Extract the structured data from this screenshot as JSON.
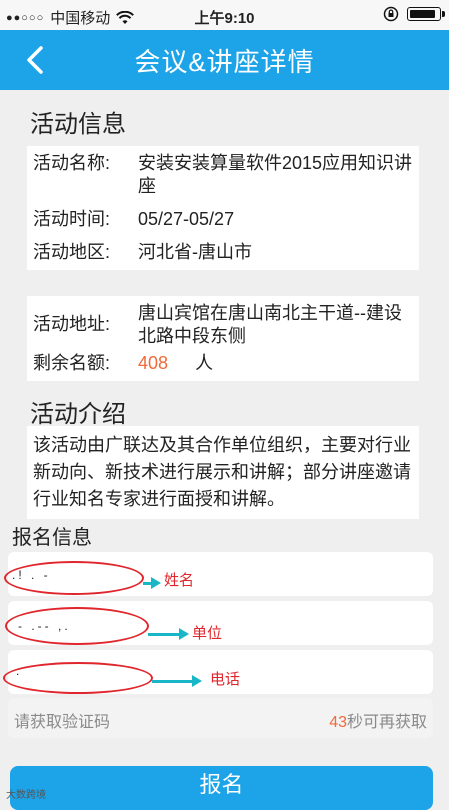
{
  "status_bar": {
    "carrier": "中国移动",
    "time": "上午9:10",
    "battery_level": 0.92
  },
  "nav": {
    "title": "会议&讲座详情"
  },
  "activity_info": {
    "heading": "活动信息",
    "rows": [
      {
        "label": "活动名称:",
        "value": "安装安装算量软件2015应用知识讲座"
      },
      {
        "label": "活动时间:",
        "value": "05/27-05/27"
      },
      {
        "label": "活动地区:",
        "value": "河北省-唐山市"
      }
    ],
    "address_label": "活动地址:",
    "address_value": "唐山宾馆在唐山南北主干道--建设北路中段东侧",
    "remaining_label": "剩余名额:",
    "remaining_count": "408",
    "remaining_unit": "人"
  },
  "intro": {
    "heading": "活动介绍",
    "text": "该活动由广联达及其合作单位组织，主要对行业新动向、新技术进行展示和讲解；部分讲座邀请行业知名专家进行面授和讲解。"
  },
  "form": {
    "heading": "报名信息",
    "fields": [
      {
        "annotation": "姓名"
      },
      {
        "annotation": "单位"
      },
      {
        "annotation": "电话"
      }
    ],
    "code_placeholder": "请获取验证码",
    "resend_count": "43",
    "resend_text": "秒可再获取",
    "submit_label": "报名"
  },
  "watermark": "大数跨境",
  "colors": {
    "accent": "#1da3e8",
    "highlight": "#f06a3a",
    "annotation": "#e0262c"
  }
}
